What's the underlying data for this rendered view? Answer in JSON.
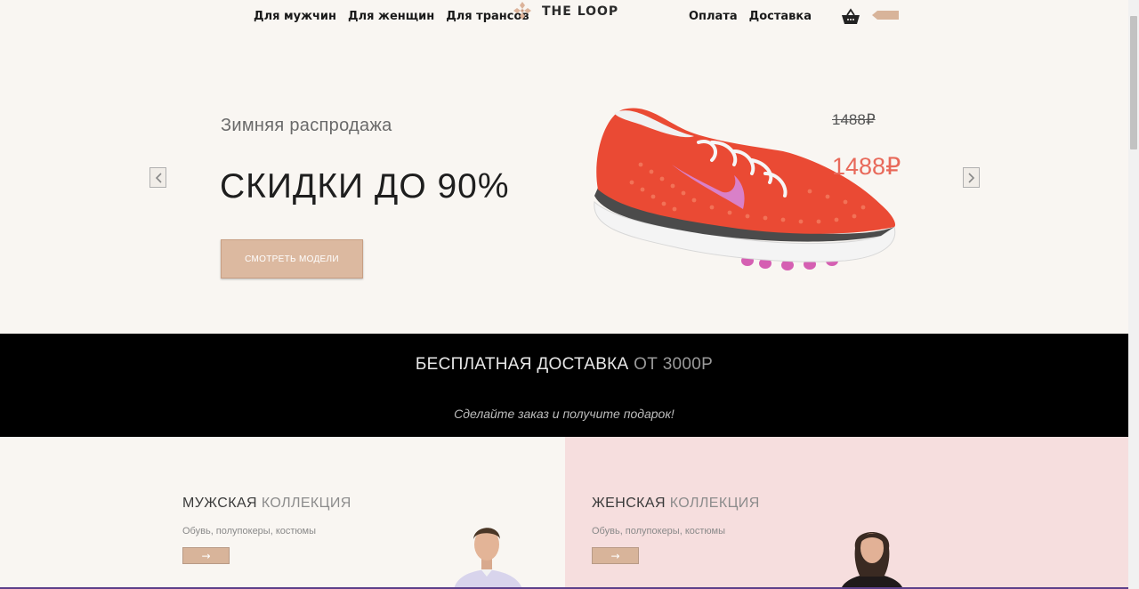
{
  "header": {
    "nav_left": [
      "Для мужчин",
      "Для женщин",
      "Для трансов"
    ],
    "logo_text": "THE LOOP",
    "nav_right": [
      "Оплата",
      "Доставка"
    ],
    "cart_icon": "basket-icon",
    "brand_color": "#dcb9a0"
  },
  "hero": {
    "subtitle": "Зимняя распродажа",
    "title": "СКИДКИ ДО 90%",
    "button_label": "СМОТРЕТЬ МОДЕЛИ",
    "old_price": "1488₽",
    "new_price": "1488₽",
    "prev_icon": "chevron-left-icon",
    "next_icon": "chevron-right-icon",
    "sale_color": "#e8695a"
  },
  "promo": {
    "title_strong": "БЕСПЛАТНАЯ ДОСТАВКА",
    "title_light": "ОТ 3000Р",
    "subtitle": "Сделайте заказ и получите подарок!"
  },
  "collections": {
    "men": {
      "title_strong": "МУЖСКАЯ",
      "title_light": "КОЛЛЕКЦИЯ",
      "description": "Обувь, полупокеры, костюмы",
      "button_label": "→"
    },
    "women": {
      "title_strong": "ЖЕНСКАЯ",
      "title_light": "КОЛЛЕКЦИЯ",
      "description": "Обувь, полупокеры, костюмы",
      "button_label": "→",
      "bg_color": "#f6dede"
    }
  }
}
